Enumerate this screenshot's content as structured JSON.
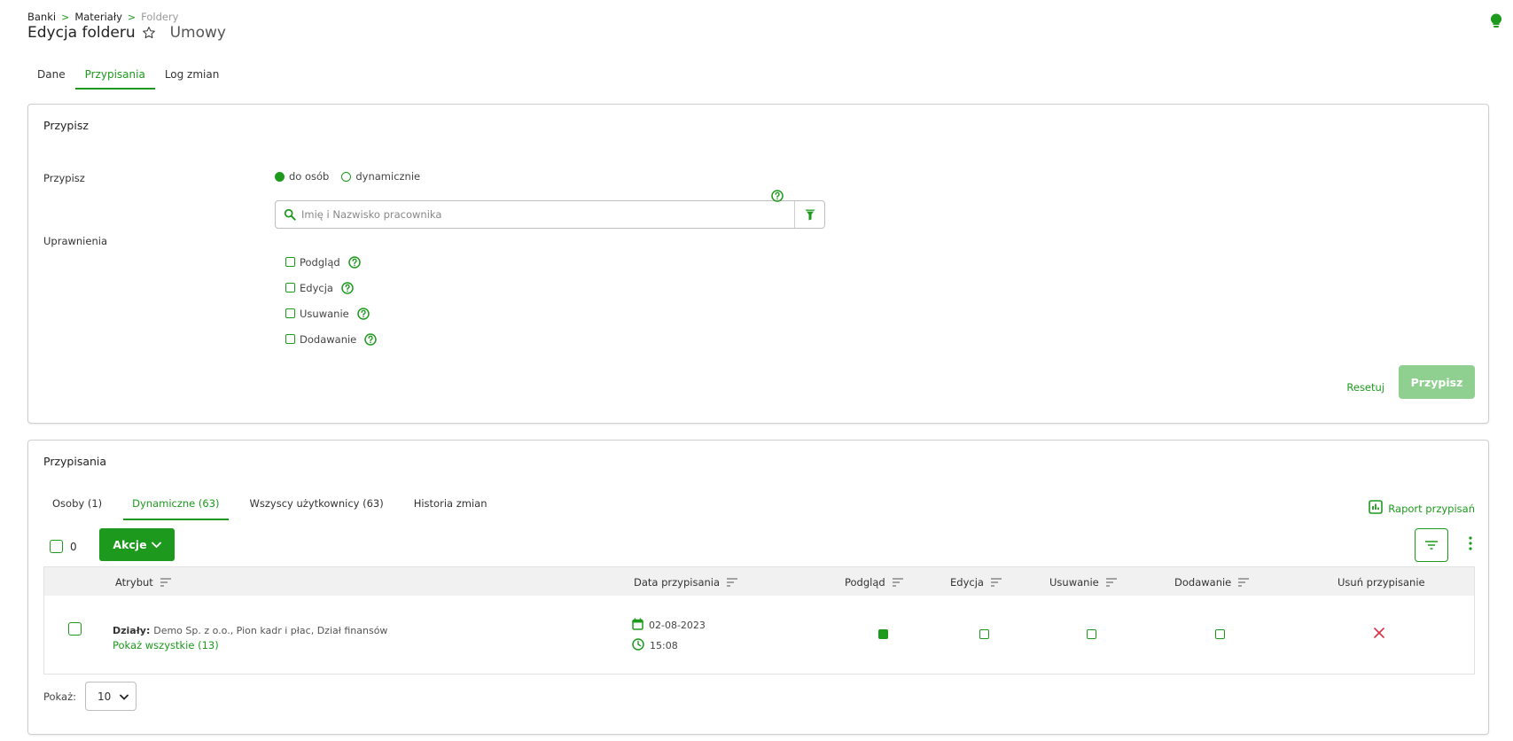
{
  "breadcrumb": {
    "items": [
      "Banki",
      "Materiały",
      "Foldery"
    ],
    "separator": ">"
  },
  "header": {
    "title": "Edycja folderu",
    "subtitle": "Umowy"
  },
  "main_tabs": [
    {
      "label": "Dane",
      "active": false
    },
    {
      "label": "Przypisania",
      "active": true
    },
    {
      "label": "Log zmian",
      "active": false
    }
  ],
  "assign_card": {
    "title": "Przypisz",
    "assign_label": "Przypisz",
    "radio_options": [
      {
        "label": "do osób",
        "selected": true
      },
      {
        "label": "dynamicznie",
        "selected": false
      }
    ],
    "search_placeholder": "Imię i Nazwisko pracownika",
    "permissions_label": "Uprawnienia",
    "permissions": [
      "Podgląd",
      "Edycja",
      "Usuwanie",
      "Dodawanie"
    ],
    "reset_label": "Resetuj",
    "submit_label": "Przypisz"
  },
  "list_card": {
    "title": "Przypisania",
    "tabs": [
      {
        "label": "Osoby (1)",
        "active": false
      },
      {
        "label": "Dynamiczne (63)",
        "active": true
      },
      {
        "label": "Wszyscy użytkownicy (63)",
        "active": false
      },
      {
        "label": "Historia zmian",
        "active": false
      }
    ],
    "report_label": "Raport przypisań",
    "selected_count": "0",
    "actions_label": "Akcje",
    "columns": [
      "Atrybut",
      "Data przypisania",
      "Podgląd",
      "Edycja",
      "Usuwanie",
      "Dodawanie",
      "Usuń przypisanie"
    ],
    "rows": [
      {
        "attr_key": "Działy:",
        "attr_value": "Demo Sp. z o.o., Pion kadr i płac, Dział finansów",
        "show_all": "Pokaż wszystkie (13)",
        "date": "02-08-2023",
        "time": "15:08",
        "podglad": true,
        "edycja": false,
        "usuwanie": false,
        "dodawanie": false
      }
    ],
    "per_page_label": "Pokaż:",
    "per_page_value": "10"
  },
  "colors": {
    "accent": "#1d9a1d",
    "accent_light": "#8fcf8f",
    "danger": "#d9304a"
  }
}
